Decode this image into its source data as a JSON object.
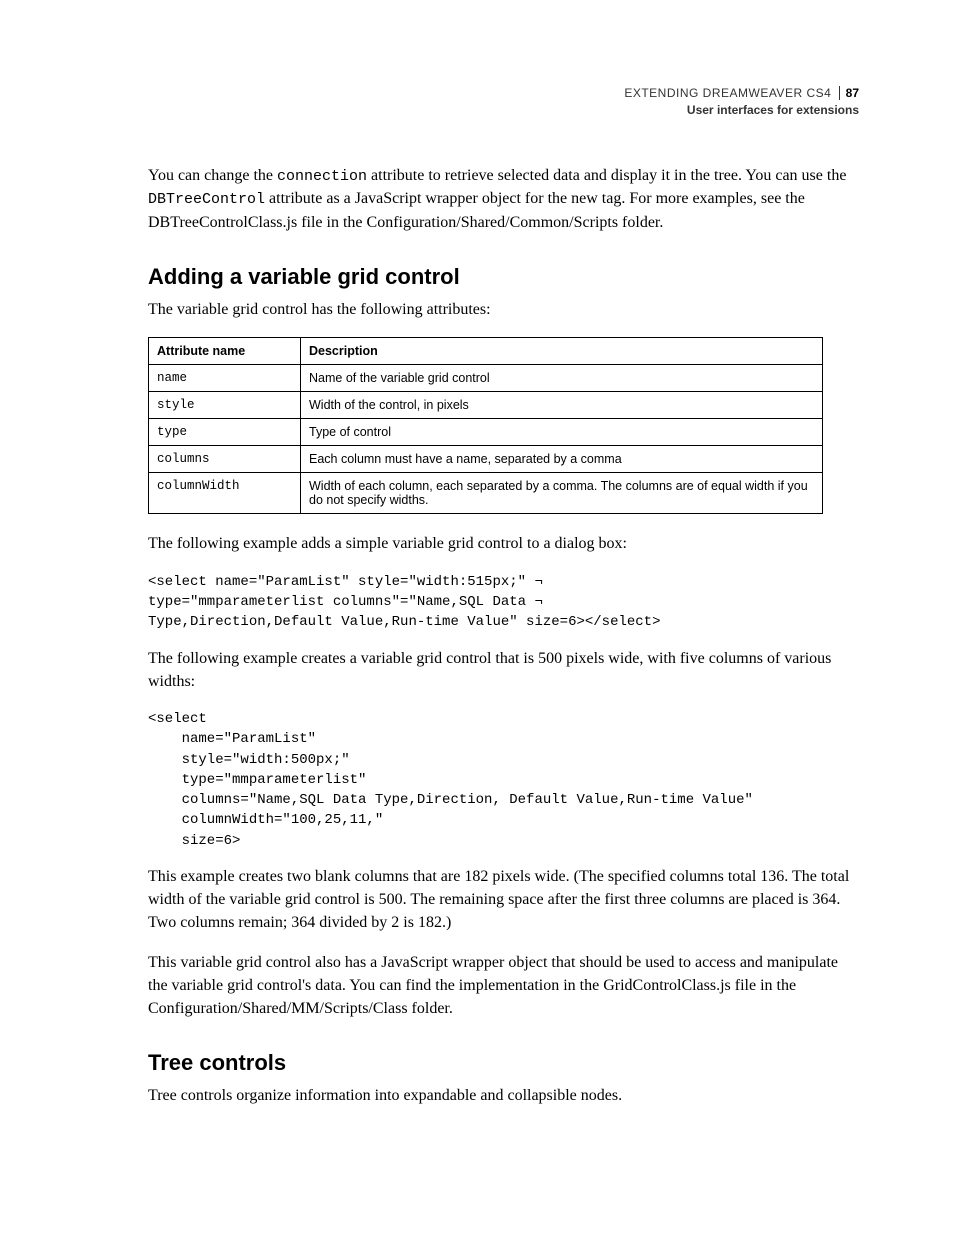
{
  "header": {
    "doc_title": "EXTENDING DREAMWEAVER CS4",
    "page_num": "87",
    "section_path": "User interfaces for extensions"
  },
  "intro": {
    "p1_a": "You can change the ",
    "p1_code1": "connection",
    "p1_b": " attribute to retrieve selected data and display it in the tree. You can use the ",
    "p1_code2": "DBTreeControl",
    "p1_c": " attribute as a JavaScript wrapper object for the new tag. For more examples, see the DBTreeControlClass.js file in the Configuration/Shared/Common/Scripts folder."
  },
  "sec1": {
    "title": "Adding a variable grid control",
    "p1": "The variable grid control has the following attributes:",
    "table": {
      "h1": "Attribute name",
      "h2": "Description",
      "rows": [
        {
          "name": "name",
          "desc": "Name of the variable grid control"
        },
        {
          "name": "style",
          "desc": "Width of the control, in pixels"
        },
        {
          "name": "type",
          "desc": "Type of control"
        },
        {
          "name": "columns",
          "desc": "Each column must have a name, separated by a comma"
        },
        {
          "name": "columnWidth",
          "desc": "Width of each column, each separated by a comma. The columns are of equal width if you do not specify widths."
        }
      ]
    },
    "p2": "The following example adds a simple variable grid control to a dialog box:",
    "code1": "<select name=\"ParamList\" style=\"width:515px;\" ¬\ntype=\"mmparameterlist columns\"=\"Name,SQL Data ¬\nType,Direction,Default Value,Run-time Value\" size=6></select>",
    "p3": "The following example creates a variable grid control that is 500 pixels wide, with five columns of various widths:",
    "code2": "<select\n    name=\"ParamList\"\n    style=\"width:500px;\"\n    type=\"mmparameterlist\"\n    columns=\"Name,SQL Data Type,Direction, Default Value,Run-time Value\"\n    columnWidth=\"100,25,11,\"\n    size=6>",
    "p4": "This example creates two blank columns that are 182 pixels wide. (The specified columns total 136. The total width of the variable grid control is 500. The remaining space after the first three columns are placed is 364. Two columns remain; 364 divided by 2 is 182.)",
    "p5": "This variable grid control also has a JavaScript wrapper object that should be used to access and manipulate the variable grid control's data. You can find the implementation in the GridControlClass.js file in the Configuration/Shared/MM/Scripts/Class folder."
  },
  "sec2": {
    "title": "Tree controls",
    "p1": "Tree controls organize information into expandable and collapsible nodes."
  }
}
